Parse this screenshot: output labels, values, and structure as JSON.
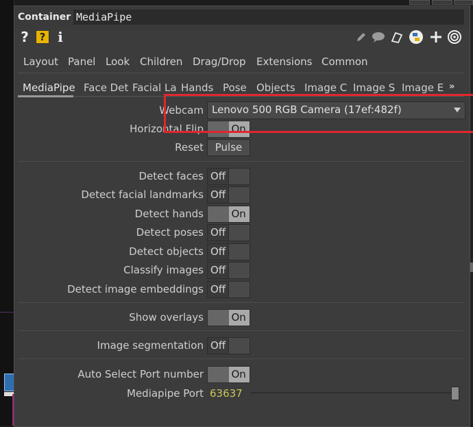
{
  "header": {
    "op_type": "Container",
    "op_name": "MediaPipe"
  },
  "toolbar_icons": [
    "help-icon",
    "operator-help-icon",
    "info-icon",
    "pencil-icon",
    "comment-icon",
    "clone-icon",
    "python-icon",
    "add-icon",
    "target-icon"
  ],
  "tabs": [
    "Layout",
    "Panel",
    "Look",
    "Children",
    "Drag/Drop",
    "Extensions",
    "Common"
  ],
  "pages": {
    "items": [
      "MediaPipe",
      "Face Det",
      "Facial La",
      "Hands",
      "Pose",
      "Objects",
      "Image C",
      "Image S",
      "Image E"
    ],
    "more": "»"
  },
  "params": {
    "webcam": {
      "label": "Webcam",
      "value": "Lenovo 500 RGB Camera (17ef:482f)"
    },
    "hflip": {
      "label": "Horizontal Flip",
      "state": "On"
    },
    "reset": {
      "label": "Reset",
      "button": "Pulse"
    },
    "detect_faces": {
      "label": "Detect faces",
      "state": "Off"
    },
    "detect_landmarks": {
      "label": "Detect facial landmarks",
      "state": "Off"
    },
    "detect_hands": {
      "label": "Detect hands",
      "state": "On"
    },
    "detect_poses": {
      "label": "Detect poses",
      "state": "Off"
    },
    "detect_objects": {
      "label": "Detect objects",
      "state": "Off"
    },
    "classify_images": {
      "label": "Classify images",
      "state": "Off"
    },
    "detect_embeddings": {
      "label": "Detect image embeddings",
      "state": "Off"
    },
    "show_overlays": {
      "label": "Show overlays",
      "state": "On"
    },
    "image_segmentation": {
      "label": "Image segmentation",
      "state": "Off"
    },
    "auto_port": {
      "label": "Auto Select Port number",
      "state": "On"
    },
    "port": {
      "label": "Mediapipe Port",
      "value": "63637"
    }
  },
  "colors": {
    "highlight": "#e3262d",
    "port_value": "#c9c85a",
    "panel": "#3c3c3c"
  }
}
